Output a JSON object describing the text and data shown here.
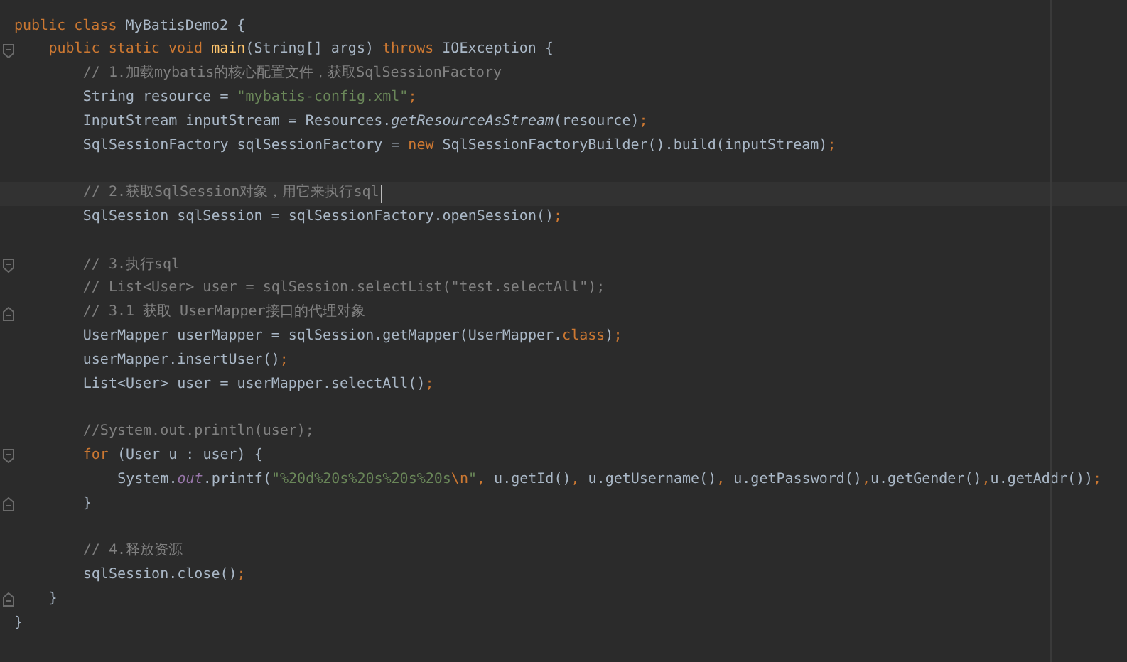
{
  "editor": {
    "lines": [
      {
        "kind": "plain",
        "current": false,
        "tokens": [
          {
            "kind": "keyword",
            "text": "public class "
          },
          {
            "kind": "plain",
            "text": "MyBatisDemo2 {"
          }
        ],
        "children": [
          {
            "kind": "opener",
            "current": false,
            "tokens": [
              {
                "kind": "keyword",
                "text": "public static void "
              },
              {
                "kind": "method",
                "text": "main"
              },
              {
                "kind": "plain",
                "text": "(String[] args) "
              },
              {
                "kind": "keyword",
                "text": "throws "
              },
              {
                "kind": "plain",
                "text": "IOException {"
              }
            ],
            "children": [
              {
                "kind": "plain",
                "current": false,
                "tokens": [
                  {
                    "kind": "comment",
                    "text": "// 1.加载mybatis的核心配置文件，获取SqlSessionFactory"
                  }
                ]
              },
              {
                "kind": "plain",
                "current": false,
                "tokens": [
                  {
                    "kind": "plain",
                    "text": "String resource = "
                  },
                  {
                    "kind": "string",
                    "text": "\"mybatis-config.xml\""
                  },
                  {
                    "kind": "keyword",
                    "text": ";"
                  }
                ]
              },
              {
                "kind": "plain",
                "current": false,
                "tokens": [
                  {
                    "kind": "plain",
                    "text": "InputStream inputStream = Resources."
                  },
                  {
                    "kind": "static",
                    "text": "getResourceAsStream"
                  },
                  {
                    "kind": "plain",
                    "text": "(resource)"
                  },
                  {
                    "kind": "keyword",
                    "text": ";"
                  }
                ]
              },
              {
                "kind": "plain",
                "current": false,
                "tokens": [
                  {
                    "kind": "plain",
                    "text": "SqlSessionFactory sqlSessionFactory = "
                  },
                  {
                    "kind": "keyword",
                    "text": "new "
                  },
                  {
                    "kind": "plain",
                    "text": "SqlSessionFactoryBuilder().build(inputStream)"
                  },
                  {
                    "kind": "keyword",
                    "text": ";"
                  }
                ]
              },
              {
                "kind": "plain",
                "current": false
              },
              {
                "kind": "plain",
                "current": true,
                "tokens": [
                  {
                    "kind": "comment",
                    "text": "// 2.获取SqlSession对象，用它来执行sql"
                  }
                ]
              },
              {
                "kind": "plain",
                "current": false,
                "tokens": [
                  {
                    "kind": "plain",
                    "text": "SqlSession sqlSession = sqlSessionFactory.openSession()"
                  },
                  {
                    "kind": "keyword",
                    "text": ";"
                  }
                ]
              },
              {
                "kind": "plain",
                "current": false
              },
              {
                "kind": "opener",
                "current": false,
                "tokens": [
                  {
                    "kind": "comment",
                    "text": "// 3.执行sql"
                  }
                ]
              },
              {
                "kind": "plain",
                "current": false,
                "tokens": [
                  {
                    "kind": "comment",
                    "text": "// List<User> user = sqlSession.selectList(\"test.selectAll\");"
                  }
                ]
              },
              {
                "kind": "closer",
                "current": false,
                "tokens": [
                  {
                    "kind": "comment",
                    "text": "// 3.1 获取 UserMapper接口的代理对象"
                  }
                ]
              },
              {
                "kind": "plain",
                "current": false,
                "tokens": [
                  {
                    "kind": "plain",
                    "text": "UserMapper userMapper = sqlSession.getMapper(UserMapper."
                  },
                  {
                    "kind": "keyword",
                    "text": "class"
                  },
                  {
                    "kind": "plain",
                    "text": ")"
                  },
                  {
                    "kind": "keyword",
                    "text": ";"
                  }
                ]
              },
              {
                "kind": "plain",
                "current": false,
                "tokens": [
                  {
                    "kind": "plain",
                    "text": "userMapper.insertUser()"
                  },
                  {
                    "kind": "keyword",
                    "text": ";"
                  }
                ]
              },
              {
                "kind": "plain",
                "current": false,
                "tokens": [
                  {
                    "kind": "plain",
                    "text": "List<User> user = userMapper.selectAll()"
                  },
                  {
                    "kind": "keyword",
                    "text": ";"
                  }
                ]
              },
              {
                "kind": "plain",
                "current": false
              },
              {
                "kind": "plain",
                "current": false,
                "tokens": [
                  {
                    "kind": "comment",
                    "text": "//System.out.println(user);"
                  }
                ]
              },
              {
                "kind": "opener",
                "current": false,
                "tokens": [
                  {
                    "kind": "keyword",
                    "text": "for "
                  },
                  {
                    "kind": "plain",
                    "text": "(User u : user) {"
                  }
                ],
                "children": [
                  {
                    "kind": "plain",
                    "current": false,
                    "tokens": [
                      {
                        "kind": "plain",
                        "text": "System."
                      },
                      {
                        "kind": "field",
                        "text": "out"
                      },
                      {
                        "kind": "plain",
                        "text": ".printf("
                      },
                      {
                        "kind": "string",
                        "text": "\"%20d%20s%20s%20s%20s"
                      },
                      {
                        "kind": "escape",
                        "text": "\\n"
                      },
                      {
                        "kind": "string",
                        "text": "\""
                      },
                      {
                        "kind": "keyword",
                        "text": ", "
                      },
                      {
                        "kind": "plain",
                        "text": "u.getId()"
                      },
                      {
                        "kind": "keyword",
                        "text": ", "
                      },
                      {
                        "kind": "plain",
                        "text": "u.getUsername()"
                      },
                      {
                        "kind": "keyword",
                        "text": ", "
                      },
                      {
                        "kind": "plain",
                        "text": "u.getPassword()"
                      },
                      {
                        "kind": "keyword",
                        "text": ","
                      },
                      {
                        "kind": "plain",
                        "text": "u.getGender()"
                      },
                      {
                        "kind": "keyword",
                        "text": ","
                      },
                      {
                        "kind": "plain",
                        "text": "u.getAddr())"
                      },
                      {
                        "kind": "keyword",
                        "text": ";"
                      }
                    ]
                  }
                ]
              },
              {
                "kind": "closer",
                "current": false,
                "tokens": [
                  {
                    "kind": "plain",
                    "text": "}"
                  }
                ]
              },
              {
                "kind": "plain",
                "current": false
              },
              {
                "kind": "plain",
                "current": false,
                "tokens": [
                  {
                    "kind": "comment",
                    "text": "// 4.释放资源"
                  }
                ]
              },
              {
                "kind": "plain",
                "current": false,
                "tokens": [
                  {
                    "kind": "plain",
                    "text": "sqlSession.close()"
                  },
                  {
                    "kind": "keyword",
                    "text": ";"
                  }
                ]
              }
            ]
          },
          {
            "kind": "closer",
            "current": false,
            "tokens": [
              {
                "kind": "plain",
                "text": "}"
              }
            ]
          }
        ]
      },
      {
        "kind": "plain",
        "current": false,
        "tokens": [
          {
            "kind": "plain",
            "text": "}"
          }
        ]
      }
    ]
  }
}
